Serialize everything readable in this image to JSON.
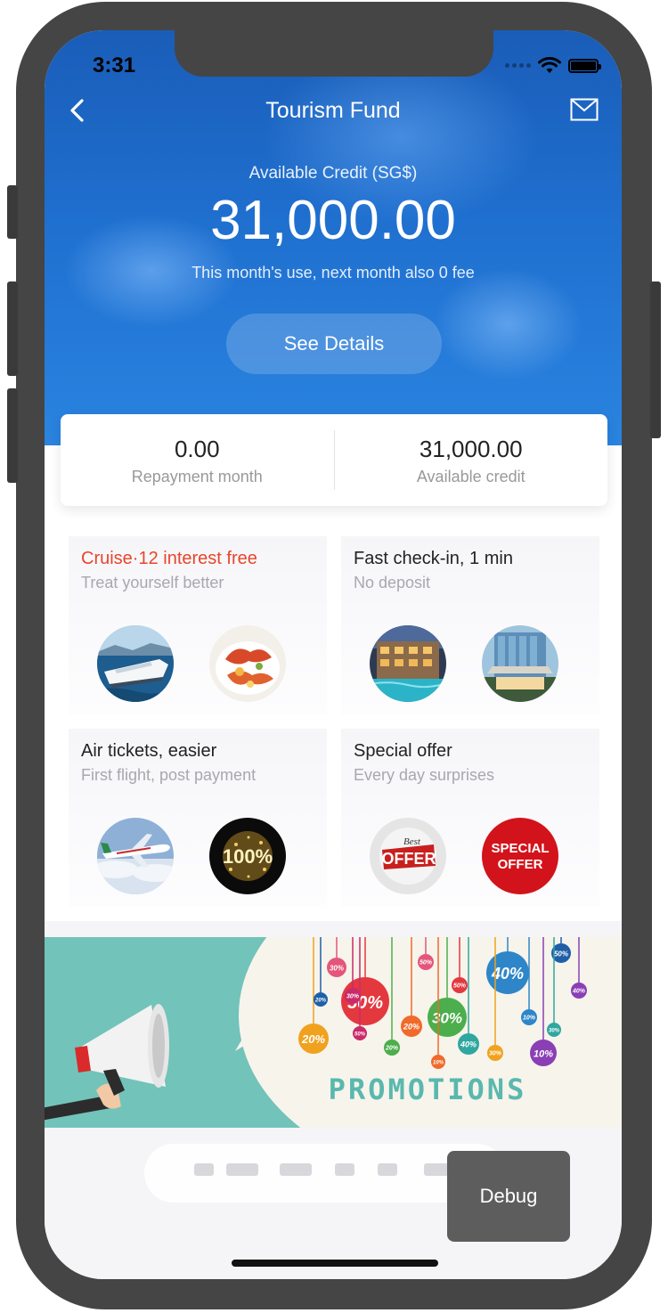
{
  "status_bar": {
    "time": "3:31"
  },
  "header": {
    "title": "Tourism Fund"
  },
  "credit": {
    "label": "Available Credit (SG$)",
    "amount": "31,000.00",
    "note": "This month's use, next month also 0 fee",
    "details_button": "See Details"
  },
  "summary": [
    {
      "value": "0.00",
      "label": "Repayment month"
    },
    {
      "value": "31,000.00",
      "label": "Available credit"
    }
  ],
  "tiles": [
    {
      "title": "Cruise·12 interest free",
      "subtitle": "Treat yourself better",
      "images": [
        "cruise-ship-photo",
        "lobster-dish-photo"
      ]
    },
    {
      "title": "Fast check-in, 1 min",
      "subtitle": "No deposit",
      "images": [
        "hotel-pool-photo",
        "hotel-entrance-photo"
      ]
    },
    {
      "title": "Air tickets, easier",
      "subtitle": "First flight, post payment",
      "images": [
        "airplane-photo",
        "gold-100-percent-badge"
      ]
    },
    {
      "title": "Special offer",
      "subtitle": "Every day surprises",
      "images": [
        "best-offer-badge",
        "special-offer-badge"
      ]
    }
  ],
  "badges": {
    "hundred": "100%",
    "offer": "OFFER",
    "best": "Best",
    "special_line1": "SPECIAL",
    "special_line2": "OFFER"
  },
  "banner": {
    "word": "PROMOTIONS",
    "tags": [
      "50%",
      "40%",
      "30%",
      "20%",
      "10%",
      "30%",
      "50%",
      "20%",
      "40%",
      "30%",
      "50%",
      "10%",
      "20%",
      "30%",
      "40%",
      "50%",
      "20%",
      "10%",
      "30%",
      "50%"
    ]
  },
  "debug_button": "Debug",
  "colors": {
    "accent_red": "#e8452b",
    "hero_blue": "#1f6fcf",
    "banner_teal": "#72c3b9",
    "promo_text": "#5ab8ae"
  }
}
